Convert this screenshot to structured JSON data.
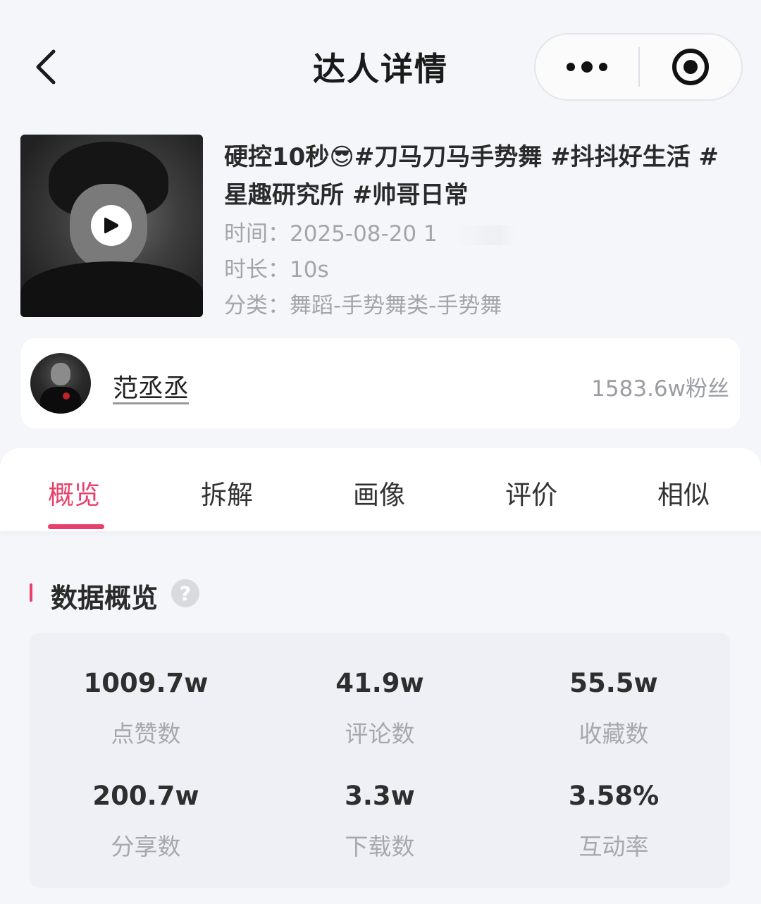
{
  "header": {
    "title": "达人详情",
    "back_icon": "chevron-left-icon",
    "more_icon": "more-dots-icon",
    "close_icon": "target-close-icon"
  },
  "video": {
    "title": "硬控10秒😎#刀马刀马手势舞 #抖抖好生活 #星趣研究所 #帅哥日常",
    "time_label": "时间：",
    "time_value": "2025-08-20 1",
    "duration_label": "时长：",
    "duration_value": "10s",
    "category_label": "分类：",
    "category_value": "舞蹈-手势舞类-手势舞",
    "play_icon": "play-icon"
  },
  "author": {
    "name": "范丞丞",
    "fans": "1583.6w粉丝"
  },
  "tabs": [
    {
      "label": "概览",
      "active": true
    },
    {
      "label": "拆解",
      "active": false
    },
    {
      "label": "画像",
      "active": false
    },
    {
      "label": "评价",
      "active": false
    },
    {
      "label": "相似",
      "active": false
    }
  ],
  "overview": {
    "section_title": "数据概览",
    "help_icon": "question-icon",
    "help_symbol": "?",
    "stats": [
      {
        "value": "1009.7w",
        "label": "点赞数"
      },
      {
        "value": "41.9w",
        "label": "评论数"
      },
      {
        "value": "55.5w",
        "label": "收藏数"
      },
      {
        "value": "200.7w",
        "label": "分享数"
      },
      {
        "value": "3.3w",
        "label": "下载数"
      },
      {
        "value": "3.58%",
        "label": "互动率"
      }
    ]
  },
  "colors": {
    "accent": "#e8406a",
    "background": "#f5f6fa",
    "stats_card": "#eef0f5",
    "muted_text": "#a3a5ab"
  }
}
